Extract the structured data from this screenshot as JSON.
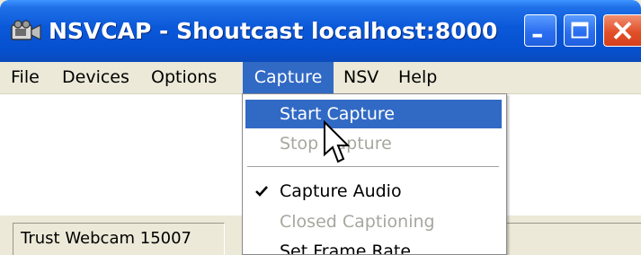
{
  "window": {
    "title": "NSVCAP - Shoutcast localhost:8000",
    "colors": {
      "title_bar": "#0a58d8",
      "menu_highlight": "#316ac5",
      "close_button": "#e2502a"
    }
  },
  "menubar": {
    "items": [
      {
        "label": "File"
      },
      {
        "label": "Devices"
      },
      {
        "label": "Options"
      },
      {
        "label": "Capture"
      },
      {
        "label": "NSV"
      },
      {
        "label": "Help"
      }
    ],
    "active": "Capture"
  },
  "capture_menu": {
    "items": [
      {
        "label": "Start Capture",
        "state": "highlighted"
      },
      {
        "label": "Stop Capture",
        "state": "disabled"
      },
      {
        "label": "Capture Audio",
        "state": "checked"
      },
      {
        "label": "Closed Captioning",
        "state": "disabled"
      },
      {
        "label": "Set Frame Rate",
        "state": "normal"
      }
    ]
  },
  "statusbar": {
    "device": "Trust Webcam 15007"
  },
  "icons": {
    "app": "camera-icon",
    "minimize": "minimize-icon",
    "maximize": "maximize-icon",
    "close": "close-icon",
    "check": "checkmark-icon",
    "cursor": "mouse-pointer-icon"
  }
}
